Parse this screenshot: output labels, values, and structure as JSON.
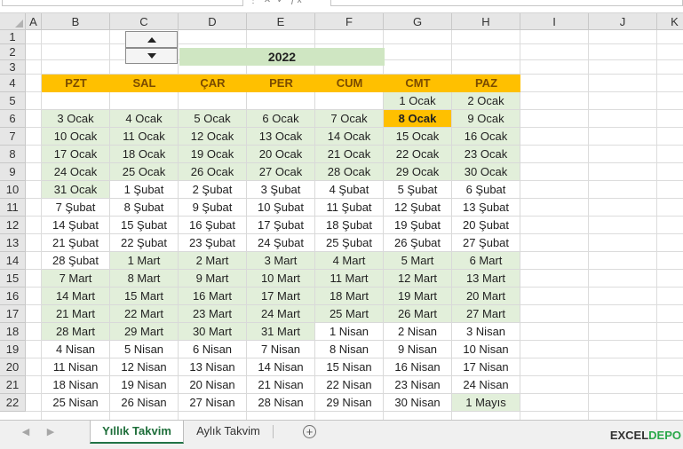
{
  "columns": [
    "A",
    "B",
    "C",
    "D",
    "E",
    "F",
    "G",
    "H",
    "I",
    "J",
    "K"
  ],
  "rows": [
    "1",
    "2",
    "3",
    "4",
    "5",
    "6",
    "7",
    "8",
    "9",
    "10",
    "11",
    "12",
    "13",
    "14",
    "15",
    "16",
    "17",
    "18",
    "19",
    "20",
    "21",
    "22"
  ],
  "year_label": "2022",
  "day_headers": [
    "PZT",
    "SAL",
    "ÇAR",
    "PER",
    "CUM",
    "CMT",
    "PAZ"
  ],
  "calendar": [
    [
      "",
      "",
      "",
      "",
      "",
      "1 Ocak",
      "2 Ocak"
    ],
    [
      "3 Ocak",
      "4 Ocak",
      "5 Ocak",
      "6 Ocak",
      "7 Ocak",
      "8 Ocak",
      "9 Ocak"
    ],
    [
      "10 Ocak",
      "11 Ocak",
      "12 Ocak",
      "13 Ocak",
      "14 Ocak",
      "15 Ocak",
      "16 Ocak"
    ],
    [
      "17 Ocak",
      "18 Ocak",
      "19 Ocak",
      "20 Ocak",
      "21 Ocak",
      "22 Ocak",
      "23 Ocak"
    ],
    [
      "24 Ocak",
      "25 Ocak",
      "26 Ocak",
      "27 Ocak",
      "28 Ocak",
      "29 Ocak",
      "30 Ocak"
    ],
    [
      "31 Ocak",
      "1 Şubat",
      "2 Şubat",
      "3 Şubat",
      "4 Şubat",
      "5 Şubat",
      "6 Şubat"
    ],
    [
      "7 Şubat",
      "8 Şubat",
      "9 Şubat",
      "10 Şubat",
      "11 Şubat",
      "12 Şubat",
      "13 Şubat"
    ],
    [
      "14 Şubat",
      "15 Şubat",
      "16 Şubat",
      "17 Şubat",
      "18 Şubat",
      "19 Şubat",
      "20 Şubat"
    ],
    [
      "21 Şubat",
      "22 Şubat",
      "23 Şubat",
      "24 Şubat",
      "25 Şubat",
      "26 Şubat",
      "27 Şubat"
    ],
    [
      "28 Şubat",
      "1 Mart",
      "2 Mart",
      "3 Mart",
      "4 Mart",
      "5 Mart",
      "6 Mart"
    ],
    [
      "7 Mart",
      "8 Mart",
      "9 Mart",
      "10 Mart",
      "11 Mart",
      "12 Mart",
      "13 Mart"
    ],
    [
      "14 Mart",
      "15 Mart",
      "16 Mart",
      "17 Mart",
      "18 Mart",
      "19 Mart",
      "20 Mart"
    ],
    [
      "21 Mart",
      "22 Mart",
      "23 Mart",
      "24 Mart",
      "25 Mart",
      "26 Mart",
      "27 Mart"
    ],
    [
      "28 Mart",
      "29 Mart",
      "30 Mart",
      "31 Mart",
      "1 Nisan",
      "2 Nisan",
      "3 Nisan"
    ],
    [
      "4 Nisan",
      "5 Nisan",
      "6 Nisan",
      "7 Nisan",
      "8 Nisan",
      "9 Nisan",
      "10 Nisan"
    ],
    [
      "11 Nisan",
      "12 Nisan",
      "13 Nisan",
      "14 Nisan",
      "15 Nisan",
      "16 Nisan",
      "17 Nisan"
    ],
    [
      "18 Nisan",
      "19 Nisan",
      "20 Nisan",
      "21 Nisan",
      "22 Nisan",
      "23 Nisan",
      "24 Nisan"
    ],
    [
      "25 Nisan",
      "26 Nisan",
      "27 Nisan",
      "28 Nisan",
      "29 Nisan",
      "30 Nisan",
      "1 Mayıs"
    ]
  ],
  "calendar_shading": [
    [
      "w",
      "w",
      "w",
      "w",
      "w",
      "g",
      "g"
    ],
    [
      "g",
      "g",
      "g",
      "g",
      "g",
      "today",
      "g"
    ],
    [
      "g",
      "g",
      "g",
      "g",
      "g",
      "g",
      "g"
    ],
    [
      "g",
      "g",
      "g",
      "g",
      "g",
      "g",
      "g"
    ],
    [
      "g",
      "g",
      "g",
      "g",
      "g",
      "g",
      "g"
    ],
    [
      "g",
      "w",
      "w",
      "w",
      "w",
      "w",
      "w"
    ],
    [
      "w",
      "w",
      "w",
      "w",
      "w",
      "w",
      "w"
    ],
    [
      "w",
      "w",
      "w",
      "w",
      "w",
      "w",
      "w"
    ],
    [
      "w",
      "w",
      "w",
      "w",
      "w",
      "w",
      "w"
    ],
    [
      "w",
      "g",
      "g",
      "g",
      "g",
      "g",
      "g"
    ],
    [
      "g",
      "g",
      "g",
      "g",
      "g",
      "g",
      "g"
    ],
    [
      "g",
      "g",
      "g",
      "g",
      "g",
      "g",
      "g"
    ],
    [
      "g",
      "g",
      "g",
      "g",
      "g",
      "g",
      "g"
    ],
    [
      "g",
      "g",
      "g",
      "g",
      "w",
      "w",
      "w"
    ],
    [
      "w",
      "w",
      "w",
      "w",
      "w",
      "w",
      "w"
    ],
    [
      "w",
      "w",
      "w",
      "w",
      "w",
      "w",
      "w"
    ],
    [
      "w",
      "w",
      "w",
      "w",
      "w",
      "w",
      "w"
    ],
    [
      "w",
      "w",
      "w",
      "w",
      "w",
      "w",
      "g"
    ]
  ],
  "tabs": {
    "active": "Yıllık Takvim",
    "second": "Aylık Takvim"
  },
  "logo": {
    "part1": "EXCEL",
    "part2": "DEPO"
  },
  "colors": {
    "header_bg": "#ffc000",
    "green_fill": "#e2efda",
    "year_fill": "#cfe6c2",
    "excel_green": "#217346"
  }
}
